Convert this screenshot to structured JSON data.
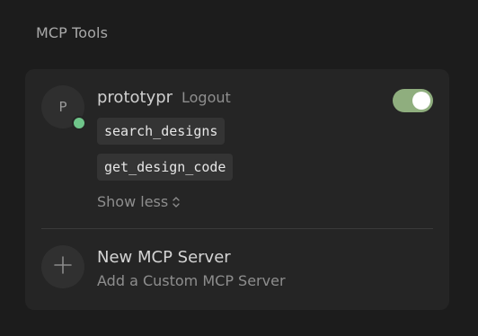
{
  "section": {
    "title": "MCP Tools"
  },
  "server": {
    "avatar_letter": "P",
    "name": "prototypr",
    "logout_label": "Logout",
    "enabled": true,
    "status": "connected",
    "tools": [
      "search_designs",
      "get_design_code"
    ],
    "toggle_tools_label": "Show less"
  },
  "add_server": {
    "title": "New MCP Server",
    "subtitle": "Add a Custom MCP Server"
  },
  "icons": {
    "status": "status-dot",
    "toggle": "toggle-switch",
    "chevron": "chevron-up-down-icon",
    "add": "plus-icon"
  },
  "colors": {
    "background": "#1c1c1c",
    "card": "#252525",
    "status_online": "#6fc58a",
    "toggle_on": "#8fae7e"
  }
}
